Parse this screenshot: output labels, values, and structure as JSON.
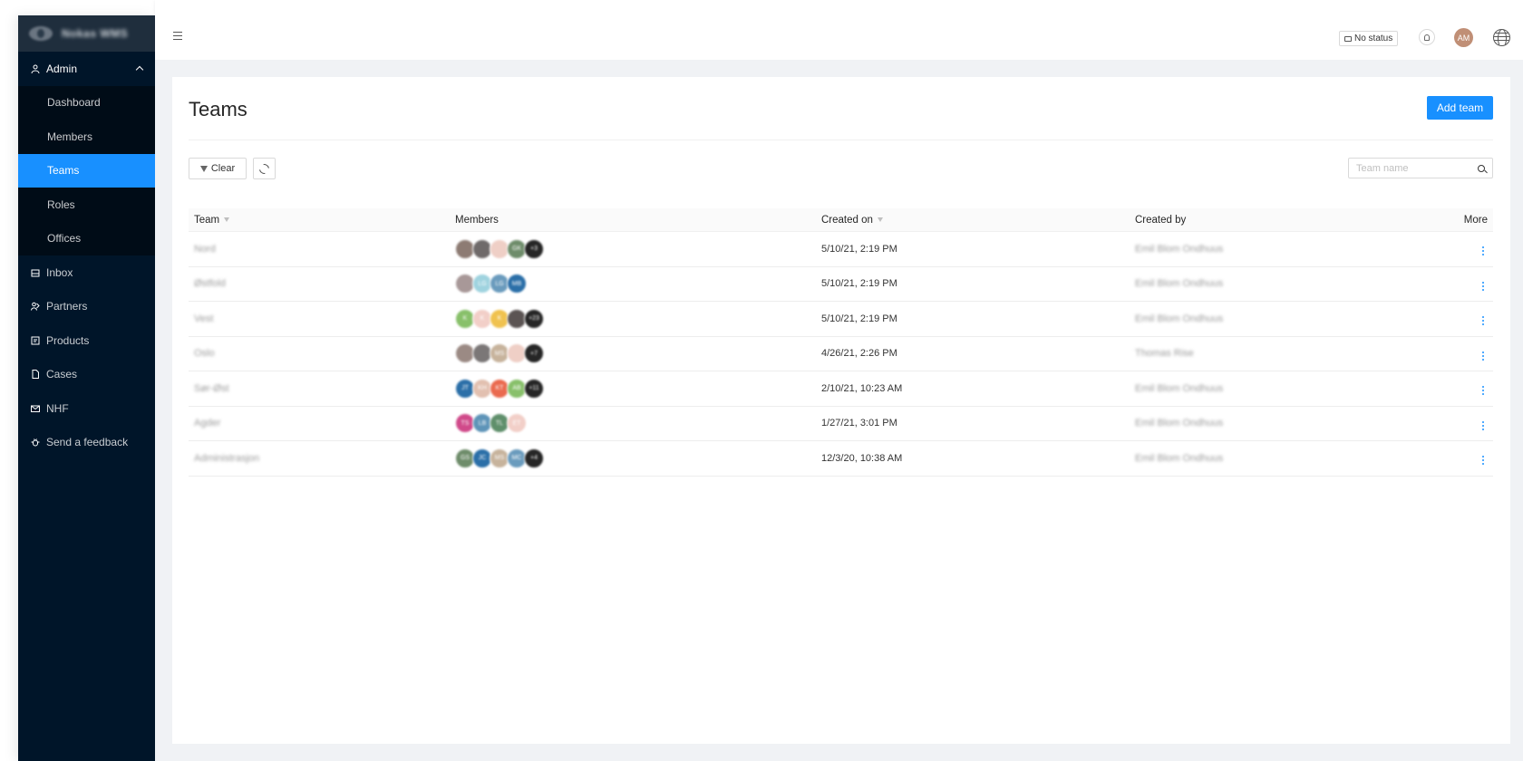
{
  "app": {
    "name": "Nokas WMS"
  },
  "sidebar": {
    "group": {
      "label": "Admin",
      "icon": "user-icon"
    },
    "subitems": [
      {
        "label": "Dashboard",
        "active": false
      },
      {
        "label": "Members",
        "active": false
      },
      {
        "label": "Teams",
        "active": true
      },
      {
        "label": "Roles",
        "active": false
      },
      {
        "label": "Offices",
        "active": false
      }
    ],
    "items": [
      {
        "label": "Inbox",
        "icon": "inbox-icon"
      },
      {
        "label": "Partners",
        "icon": "partners-icon"
      },
      {
        "label": "Products",
        "icon": "products-icon"
      },
      {
        "label": "Cases",
        "icon": "file-icon"
      },
      {
        "label": "NHF",
        "icon": "mail-icon"
      },
      {
        "label": "Send a feedback",
        "icon": "bug-icon"
      }
    ]
  },
  "header": {
    "status": "No status",
    "avatar_initials": "AM"
  },
  "page": {
    "title": "Teams",
    "add_button": "Add team",
    "clear_button": "Clear",
    "search_placeholder": "Team name"
  },
  "table": {
    "columns": [
      "Team",
      "Members",
      "Created on",
      "Created by",
      "More"
    ],
    "rows": [
      {
        "team": "Nord",
        "created_on": "5/10/21, 2:19 PM",
        "created_by": "Emil Blom Ondhuus",
        "members": [
          {
            "c": "#8d7b73",
            "t": ""
          },
          {
            "c": "#6f6a6a",
            "t": ""
          },
          {
            "c": "#efcfc6",
            "t": ""
          },
          {
            "c": "#6e8c6a",
            "t": "GK"
          },
          {
            "c": "#262626",
            "t": "+3"
          }
        ]
      },
      {
        "team": "Østfold",
        "created_on": "5/10/21, 2:19 PM",
        "created_by": "Emil Blom Ondhuus",
        "members": [
          {
            "c": "#a89898",
            "t": ""
          },
          {
            "c": "#9fd3df",
            "t": "LG"
          },
          {
            "c": "#6a9bbd",
            "t": "LG"
          },
          {
            "c": "#2b6fa8",
            "t": "MB"
          }
        ]
      },
      {
        "team": "Vest",
        "created_on": "5/10/21, 2:19 PM",
        "created_by": "Emil Blom Ondhuus",
        "members": [
          {
            "c": "#88c06a",
            "t": "K"
          },
          {
            "c": "#f2cfc8",
            "t": "K"
          },
          {
            "c": "#f0c24f",
            "t": "K"
          },
          {
            "c": "#5b5453",
            "t": ""
          },
          {
            "c": "#262626",
            "t": "+23"
          }
        ]
      },
      {
        "team": "Oslo",
        "created_on": "4/26/21, 2:26 PM",
        "created_by": "Thomas Rise",
        "members": [
          {
            "c": "#9b8a84",
            "t": ""
          },
          {
            "c": "#7b7777",
            "t": ""
          },
          {
            "c": "#c7b39c",
            "t": "MS"
          },
          {
            "c": "#efcfc6",
            "t": ""
          },
          {
            "c": "#262626",
            "t": "+7"
          }
        ]
      },
      {
        "team": "Sør-Øst",
        "created_on": "2/10/21, 10:23 AM",
        "created_by": "Emil Blom Ondhuus",
        "members": [
          {
            "c": "#2b6fa8",
            "t": "JT"
          },
          {
            "c": "#e2c0b0",
            "t": "KH"
          },
          {
            "c": "#ea6a4f",
            "t": "KT"
          },
          {
            "c": "#88c06a",
            "t": "AB"
          },
          {
            "c": "#262626",
            "t": "+11"
          }
        ]
      },
      {
        "team": "Agder",
        "created_on": "1/27/21, 3:01 PM",
        "created_by": "Emil Blom Ondhuus",
        "members": [
          {
            "c": "#d04a8a",
            "t": "TS"
          },
          {
            "c": "#5e94b8",
            "t": "LB"
          },
          {
            "c": "#5f8f6b",
            "t": "TL"
          },
          {
            "c": "#f2cfc8",
            "t": "ET"
          }
        ]
      },
      {
        "team": "Administrasjon",
        "created_on": "12/3/20, 10:38 AM",
        "created_by": "Emil Blom Ondhuus",
        "members": [
          {
            "c": "#6e8c6a",
            "t": "GS"
          },
          {
            "c": "#2b6fa8",
            "t": "JC"
          },
          {
            "c": "#c7b39c",
            "t": "MS"
          },
          {
            "c": "#6a9bbd",
            "t": "MC"
          },
          {
            "c": "#262626",
            "t": "+4"
          }
        ]
      }
    ]
  },
  "colors": {
    "primary": "#1890ff",
    "sidebar": "#001529",
    "sidebar_sub": "#000c17"
  }
}
